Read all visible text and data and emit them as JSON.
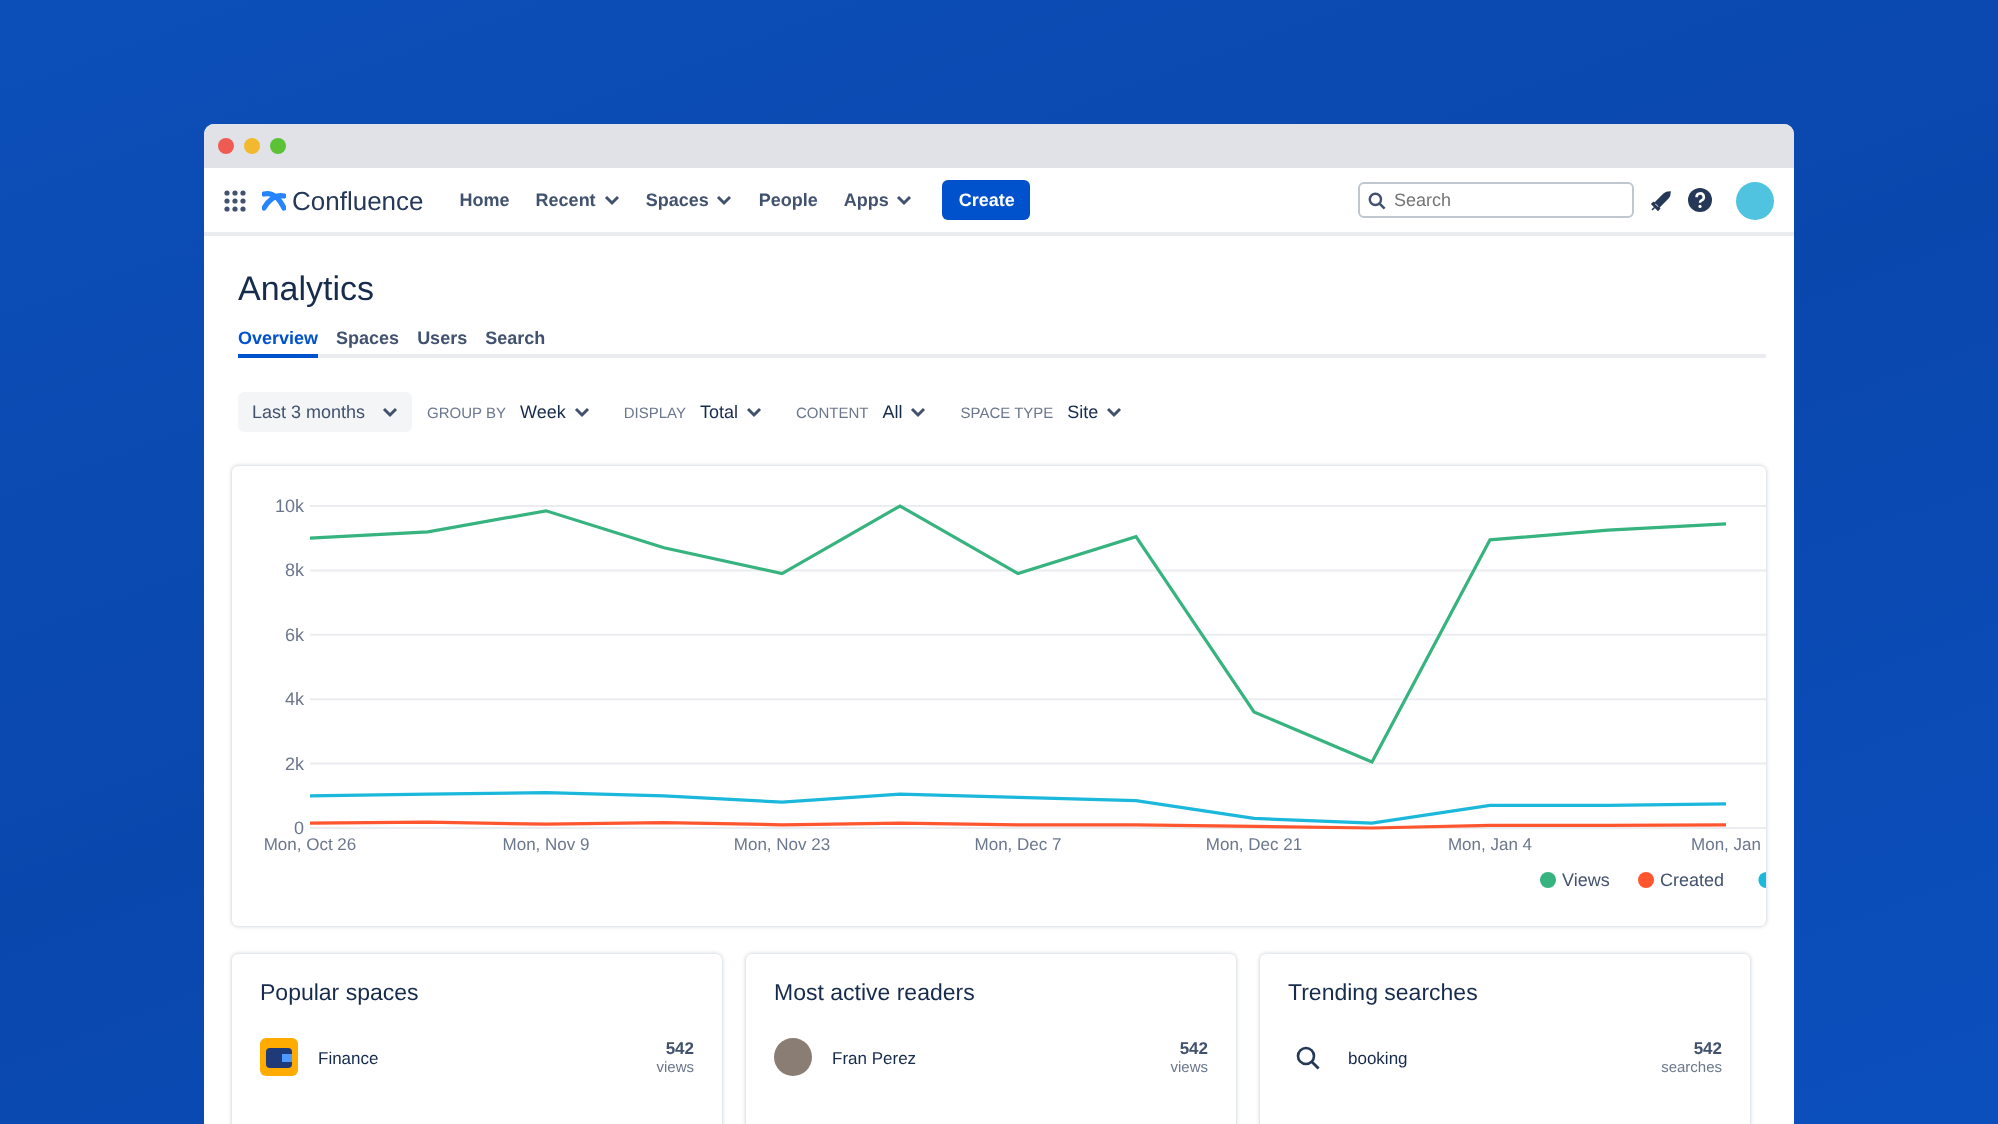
{
  "nav": {
    "logo": "Confluence",
    "items": [
      {
        "label": "Home",
        "dropdown": false
      },
      {
        "label": "Recent",
        "dropdown": true
      },
      {
        "label": "Spaces",
        "dropdown": true
      },
      {
        "label": "People",
        "dropdown": false
      },
      {
        "label": "Apps",
        "dropdown": true
      }
    ],
    "create": "Create",
    "search": {
      "placeholder": "Search"
    }
  },
  "page": {
    "title": "Analytics",
    "tabs": [
      {
        "label": "Overview",
        "selected": true
      },
      {
        "label": "Spaces",
        "selected": false
      },
      {
        "label": "Users",
        "selected": false
      },
      {
        "label": "Search",
        "selected": false
      }
    ]
  },
  "filters": {
    "range": "Last 3 months",
    "items": [
      {
        "label": "GROUP BY",
        "value": "Week"
      },
      {
        "label": "DISPLAY",
        "value": "Total"
      },
      {
        "label": "CONTENT",
        "value": "All"
      },
      {
        "label": "SPACE TYPE",
        "value": "Site"
      }
    ]
  },
  "chart_data": {
    "type": "line",
    "grid": true,
    "legend": "bottom-right",
    "categories": [
      "Mon, Oct 26",
      null,
      "Mon, Nov 9",
      null,
      "Mon, Nov 23",
      null,
      "Mon, Dec 7",
      null,
      "Mon, Dec 21",
      null,
      "Mon, Jan 4",
      null,
      "Mon, Jan"
    ],
    "ylim": [
      0,
      10000
    ],
    "yticks": [
      {
        "value": 0,
        "label": "0"
      },
      {
        "value": 2000,
        "label": "2k"
      },
      {
        "value": 4000,
        "label": "4k"
      },
      {
        "value": 6000,
        "label": "6k"
      },
      {
        "value": 8000,
        "label": "8k"
      },
      {
        "value": 10000,
        "label": "10k"
      }
    ],
    "series": [
      {
        "name": "Views",
        "color": "#36b37e",
        "values": [
          9000,
          9200,
          9850,
          8700,
          7900,
          10000,
          7900,
          9050,
          3600,
          2050,
          8950,
          9250,
          9450
        ]
      },
      {
        "name": "Created",
        "color": "#ff5630",
        "values": [
          150,
          180,
          120,
          170,
          100,
          150,
          100,
          100,
          50,
          0,
          80,
          80,
          100
        ]
      },
      {
        "color": "#1cb8dc",
        "values": [
          1000,
          1050,
          1100,
          1000,
          800,
          1050,
          950,
          850,
          300,
          150,
          700,
          700,
          750
        ]
      }
    ]
  },
  "cards": [
    {
      "title": "Popular spaces",
      "kind": "space",
      "rows": [
        {
          "name": "Finance",
          "count": "542",
          "unit": "views"
        }
      ]
    },
    {
      "title": "Most active readers",
      "kind": "person",
      "rows": [
        {
          "name": "Fran Perez",
          "count": "542",
          "unit": "views"
        }
      ]
    },
    {
      "title": "Trending searches",
      "kind": "search",
      "rows": [
        {
          "name": "booking",
          "count": "542",
          "unit": "searches"
        }
      ]
    }
  ]
}
